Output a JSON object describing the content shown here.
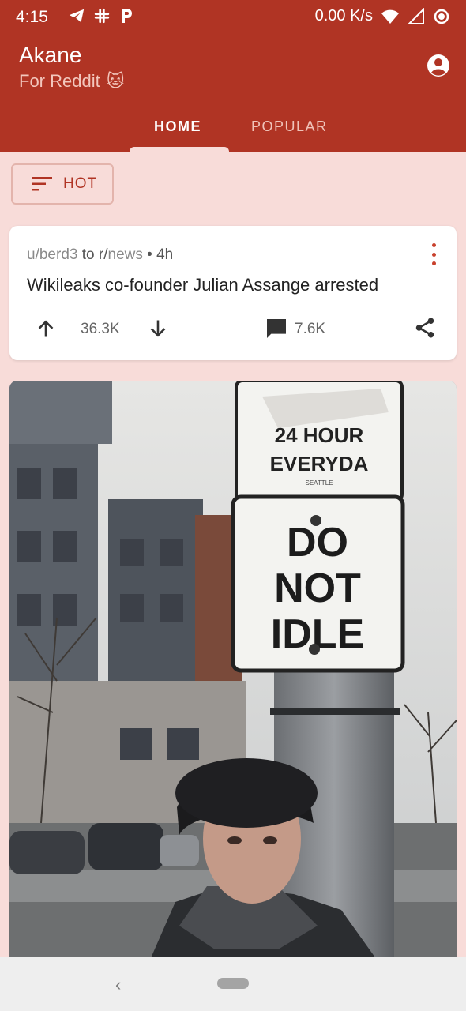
{
  "status_bar": {
    "time": "4:15",
    "speed": "0.00 K/s",
    "icons": [
      "telegram-icon",
      "slack-icon",
      "p-icon",
      "wifi-icon",
      "signal-icon",
      "record-icon"
    ]
  },
  "app_bar": {
    "title": "Akane",
    "subtitle": "For Reddit",
    "subtitle_emoji": "🐱",
    "tabs": [
      {
        "label": "HOME",
        "active": true
      },
      {
        "label": "POPULAR",
        "active": false
      }
    ]
  },
  "sort": {
    "label": "HOT"
  },
  "post": {
    "author_prefix": "u/",
    "author": "berd3",
    "to": "to",
    "subreddit_prefix": "r/",
    "subreddit": "news",
    "age": "• 4h",
    "title": "Wikileaks co-founder Julian Assange arrested",
    "score": "36.3K",
    "comments": "7.6K"
  },
  "image_post": {
    "sign_top_line1": "24 HOUR",
    "sign_top_line2": "EVERYDA",
    "sign_top_small": "SEATTLE",
    "sign_bottom_line1": "DO",
    "sign_bottom_line2": "NOT",
    "sign_bottom_line3": "IDLE"
  },
  "nav_bar": {
    "back": "‹"
  },
  "colors": {
    "primary": "#b03424",
    "background": "#f8dcd9",
    "accent": "#c8402c"
  }
}
